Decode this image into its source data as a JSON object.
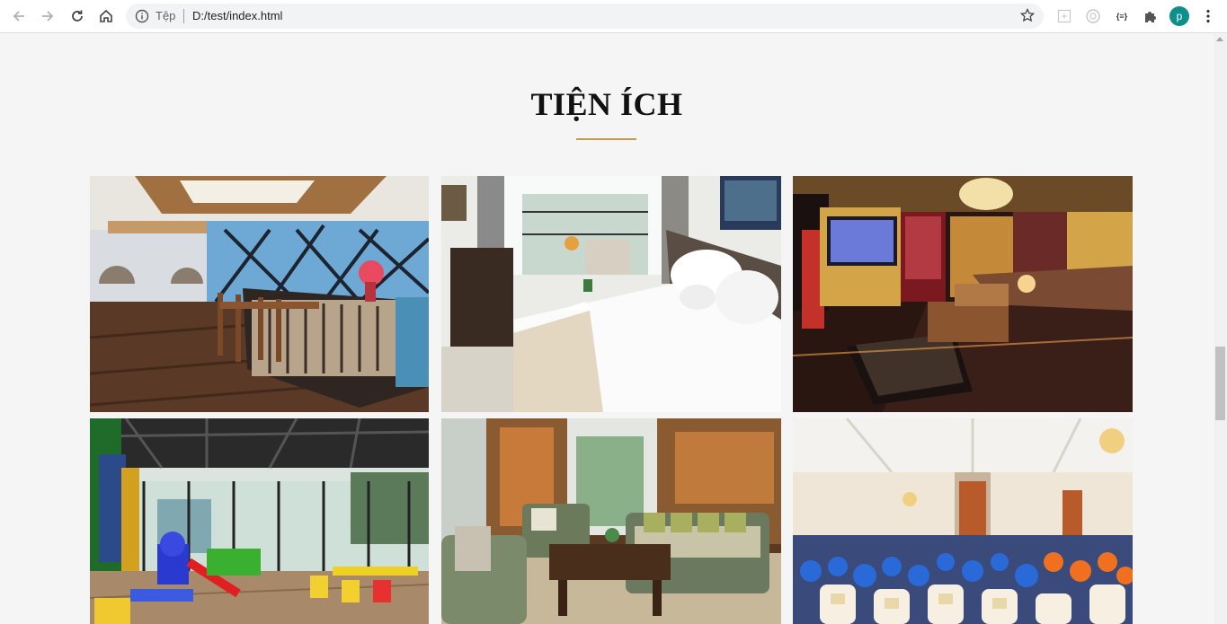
{
  "browser": {
    "scheme_label": "Tệp",
    "url": "D:/test/index.html",
    "extension_label": "{≡}",
    "profile_initial": "p"
  },
  "section": {
    "title": "TIỆN ÍCH",
    "accent_color": "#c59a4a"
  },
  "gallery": [
    {
      "subject": "bar"
    },
    {
      "subject": "bedroom"
    },
    {
      "subject": "karaoke-room"
    },
    {
      "subject": "kids-playroom"
    },
    {
      "subject": "lounge"
    },
    {
      "subject": "banquet-hall"
    }
  ]
}
